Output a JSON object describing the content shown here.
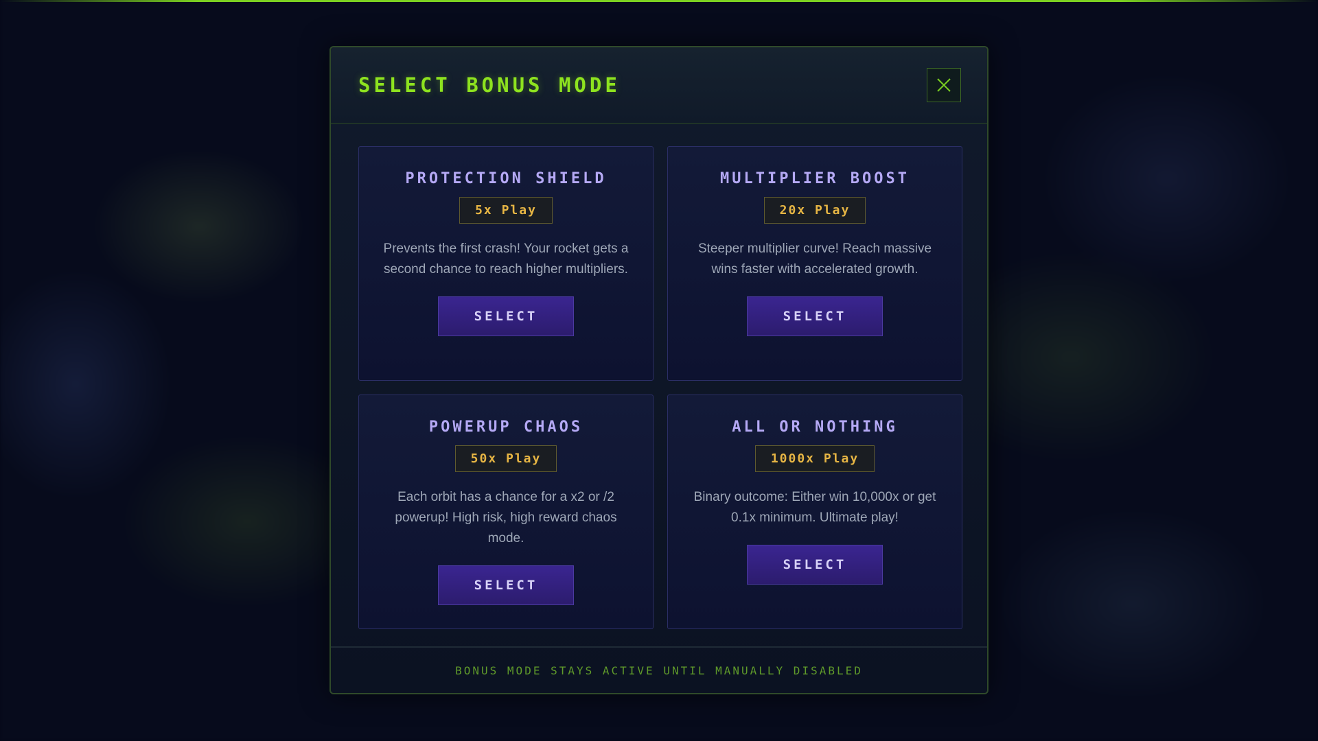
{
  "modal": {
    "title": "SELECT BONUS MODE",
    "close_icon": "close-icon",
    "footer_note": "BONUS MODE STAYS ACTIVE UNTIL MANUALLY DISABLED"
  },
  "modes": [
    {
      "title": "PROTECTION SHIELD",
      "price": "5x Play",
      "description": "Prevents the first crash! Your rocket gets a second chance to reach higher multipliers.",
      "button_label": "SELECT"
    },
    {
      "title": "MULTIPLIER BOOST",
      "price": "20x Play",
      "description": "Steeper multiplier curve! Reach massive wins faster with accelerated growth.",
      "button_label": "SELECT"
    },
    {
      "title": "POWERUP CHAOS",
      "price": "50x Play",
      "description": "Each orbit has a chance for a x2 or /2 powerup! High risk, high reward chaos mode.",
      "button_label": "SELECT"
    },
    {
      "title": "ALL OR NOTHING",
      "price": "1000x Play",
      "description": "Binary outcome: Either win 10,000x or get 0.1x minimum. Ultimate play!",
      "button_label": "SELECT"
    }
  ],
  "colors": {
    "accent_green": "#8ee31f",
    "card_title": "#b5a9f5",
    "price_gold": "#e6b544",
    "button_purple": "#3a2590"
  }
}
